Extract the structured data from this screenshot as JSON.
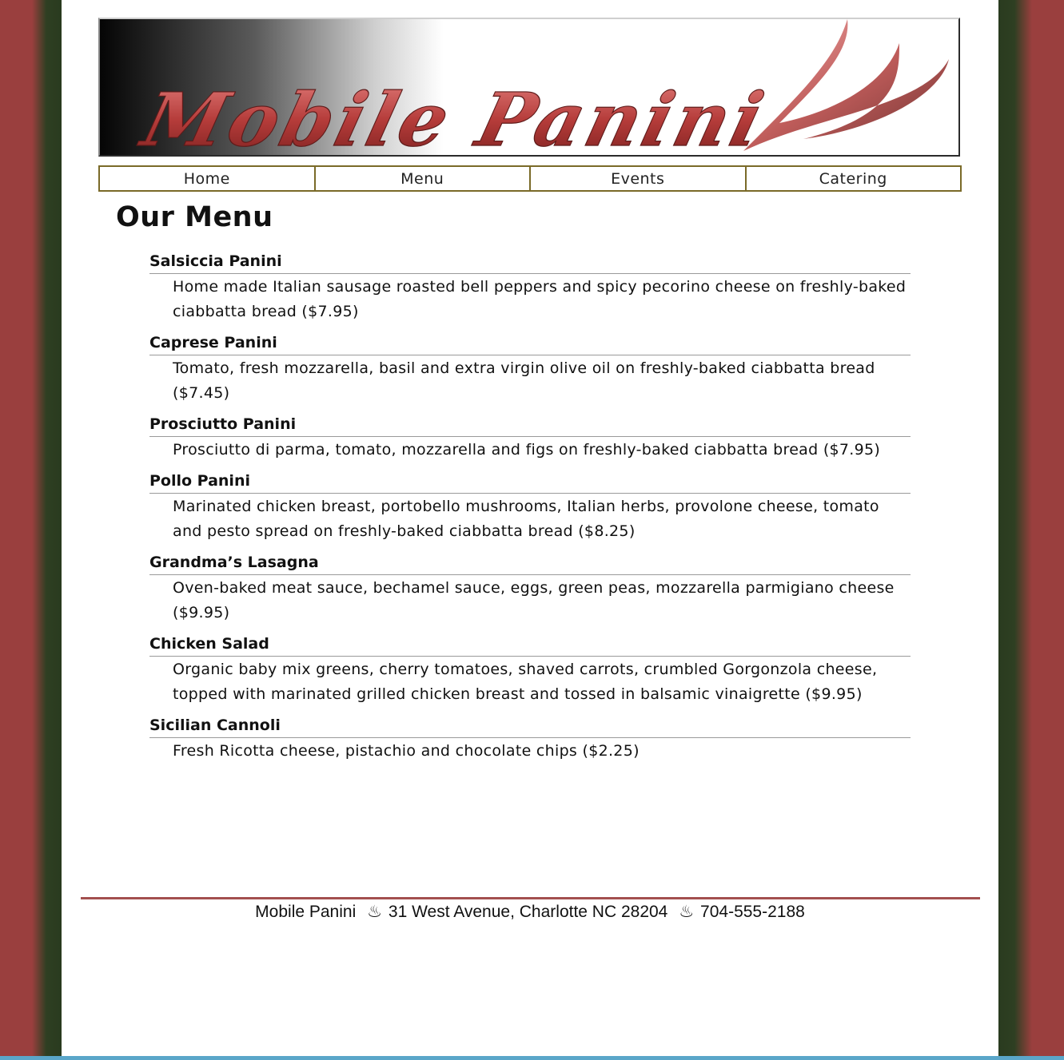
{
  "brand": {
    "logo_text": "Mobile Panini"
  },
  "nav": {
    "items": [
      "Home",
      "Menu",
      "Events",
      "Catering"
    ]
  },
  "main": {
    "title": "Our Menu",
    "items": [
      {
        "name": "Salsiccia Panini",
        "desc": "Home made Italian sausage roasted bell peppers and spicy pecorino cheese on freshly-baked ciabbatta bread ($7.95)"
      },
      {
        "name": "Caprese Panini",
        "desc": "Tomato, fresh mozzarella, basil and extra virgin olive oil on freshly-baked ciabbatta bread ($7.45)"
      },
      {
        "name": "Prosciutto Panini",
        "desc": "Prosciutto di parma, tomato, mozzarella and figs on freshly-baked ciabbatta bread ($7.95)"
      },
      {
        "name": "Pollo Panini",
        "desc": "Marinated chicken breast, portobello mushrooms, Italian herbs, provolone cheese, tomato and pesto spread on freshly-baked ciabbatta bread ($8.25)"
      },
      {
        "name": "Grandma’s Lasagna",
        "desc": "Oven-baked meat sauce, bechamel sauce, eggs, green peas, mozzarella parmigiano cheese ($9.95)"
      },
      {
        "name": "Chicken Salad",
        "desc": "Organic baby mix greens, cherry tomatoes, shaved carrots, crumbled Gorgonzola cheese, topped with marinated grilled chicken breast and tossed in balsamic vinaigrette ($9.95)"
      },
      {
        "name": "Sicilian Cannoli",
        "desc": "Fresh Ricotta cheese, pistachio and chocolate chips ($2.25)"
      }
    ]
  },
  "footer": {
    "name": "Mobile Panini",
    "separator": "♨",
    "address": "31 West Avenue, Charlotte NC   28204",
    "phone": "704-555-2188"
  },
  "colors": {
    "side_red": "#9a3f3e",
    "side_green": "#2a3b1f",
    "accent_red": "#a3504f",
    "nav_border": "#7a6a28"
  }
}
